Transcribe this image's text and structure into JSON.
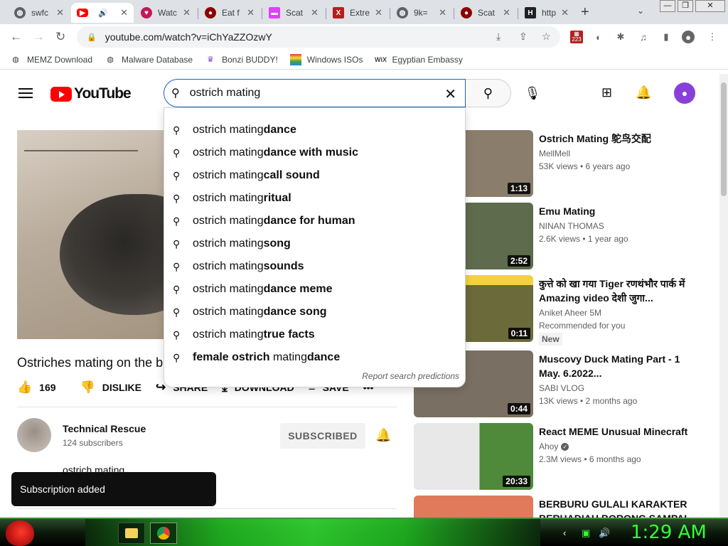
{
  "browser": {
    "tabs": [
      {
        "title": "swfc",
        "color": "#5f6368",
        "active": false
      },
      {
        "title": "",
        "color": "#ff0000",
        "active": true
      },
      {
        "title": "Watc",
        "color": "#c2185b",
        "active": false
      },
      {
        "title": "Eat f",
        "color": "#8b0000",
        "active": false
      },
      {
        "title": "Scat",
        "color": "#e040fb",
        "active": false
      },
      {
        "title": "Extre",
        "color": "#b71c1c",
        "active": false
      },
      {
        "title": "9k=",
        "color": "#5f6368",
        "active": false
      },
      {
        "title": "Scat",
        "color": "#8b0000",
        "active": false
      },
      {
        "title": "http",
        "color": "#202124",
        "active": false
      }
    ],
    "url": "youtube.com/watch?v=iChYaZZOzwY",
    "bookmarks": [
      {
        "label": "MEMZ Download",
        "icon": "globe-icon"
      },
      {
        "label": "Malware Database",
        "icon": "globe-icon"
      },
      {
        "label": "Bonzi BUDDY!",
        "icon": "bonzi-icon"
      },
      {
        "label": "Windows ISOs",
        "icon": "windows-icon"
      },
      {
        "label": "Egyptian Embassy",
        "icon": "wix-icon"
      }
    ],
    "ext_badge": "223"
  },
  "youtube": {
    "logo_text": "YouTube",
    "search_value": "ostrich mating",
    "suggestions": [
      {
        "q": "ostrich mating",
        "s": " dance"
      },
      {
        "q": "ostrich mating",
        "s": " dance with music"
      },
      {
        "q": "ostrich mating",
        "s": " call sound"
      },
      {
        "q": "ostrich mating",
        "s": " ritual"
      },
      {
        "q": "ostrich mating",
        "s": " dance for human"
      },
      {
        "q": "ostrich mating",
        "s": " song"
      },
      {
        "q": "ostrich mating",
        "s": " sounds"
      },
      {
        "q": "ostrich mating",
        "s": " dance meme"
      },
      {
        "q": "ostrich mating",
        "s": " dance song"
      },
      {
        "q": "ostrich mating",
        "s": " true facts"
      },
      {
        "pre": "female ostrich ",
        "q": "mating",
        "s": " dance"
      }
    ],
    "report_text": "Report search predictions",
    "video": {
      "title": "Ostriches mating on the b",
      "likes": "169",
      "dislike_label": "DISLIKE",
      "share_label": "SHARE",
      "download_label": "DOWNLOAD",
      "save_label": "SAVE"
    },
    "channel": {
      "name": "Technical Rescue",
      "subs": "124 subscribers",
      "sub_label": "SUBSCRIBED"
    },
    "description": "ostrich mating",
    "toast": "Subscription added",
    "recommendations": [
      {
        "title": "Ostrich Mating 鸵鸟交配",
        "channel": "MellMell",
        "meta": "53K views • 6 years ago",
        "duration": "1:13",
        "bg": "#8a7d6b"
      },
      {
        "title": "Emu Mating",
        "channel": "NINAN THOMAS",
        "meta": "2.6K views • 1 year ago",
        "duration": "2:52",
        "bg": "#5e6b4c"
      },
      {
        "title": "कुत्ते को खा गया Tiger रणथंभौर पार्क में Amazing video देशी जुगा...",
        "channel": "Aniket Aheer 5M",
        "meta": "Recommended for you",
        "badge": "New",
        "duration": "0:11",
        "bg": "#6b6a3a"
      },
      {
        "title": "Muscovy Duck Mating Part - 1 May. 6.2022...",
        "channel": "SABI VLOG",
        "meta": "13K views • 2 months ago",
        "duration": "0:44",
        "bg": "#7a6f63"
      },
      {
        "title": "React MEME Unusual Minecraft",
        "channel": "Ahoy",
        "verified": true,
        "meta": "2.3M views • 6 months ago",
        "duration": "20:33",
        "bg": "#4f8a3a"
      },
      {
        "title": "BERBURU GULALI KARAKTER BERHADIAH BORONG SAMPAI",
        "channel": "",
        "meta": "",
        "duration": "",
        "bg": "#e07a5a"
      }
    ]
  },
  "taskbar": {
    "clock": "1:29 AM"
  }
}
